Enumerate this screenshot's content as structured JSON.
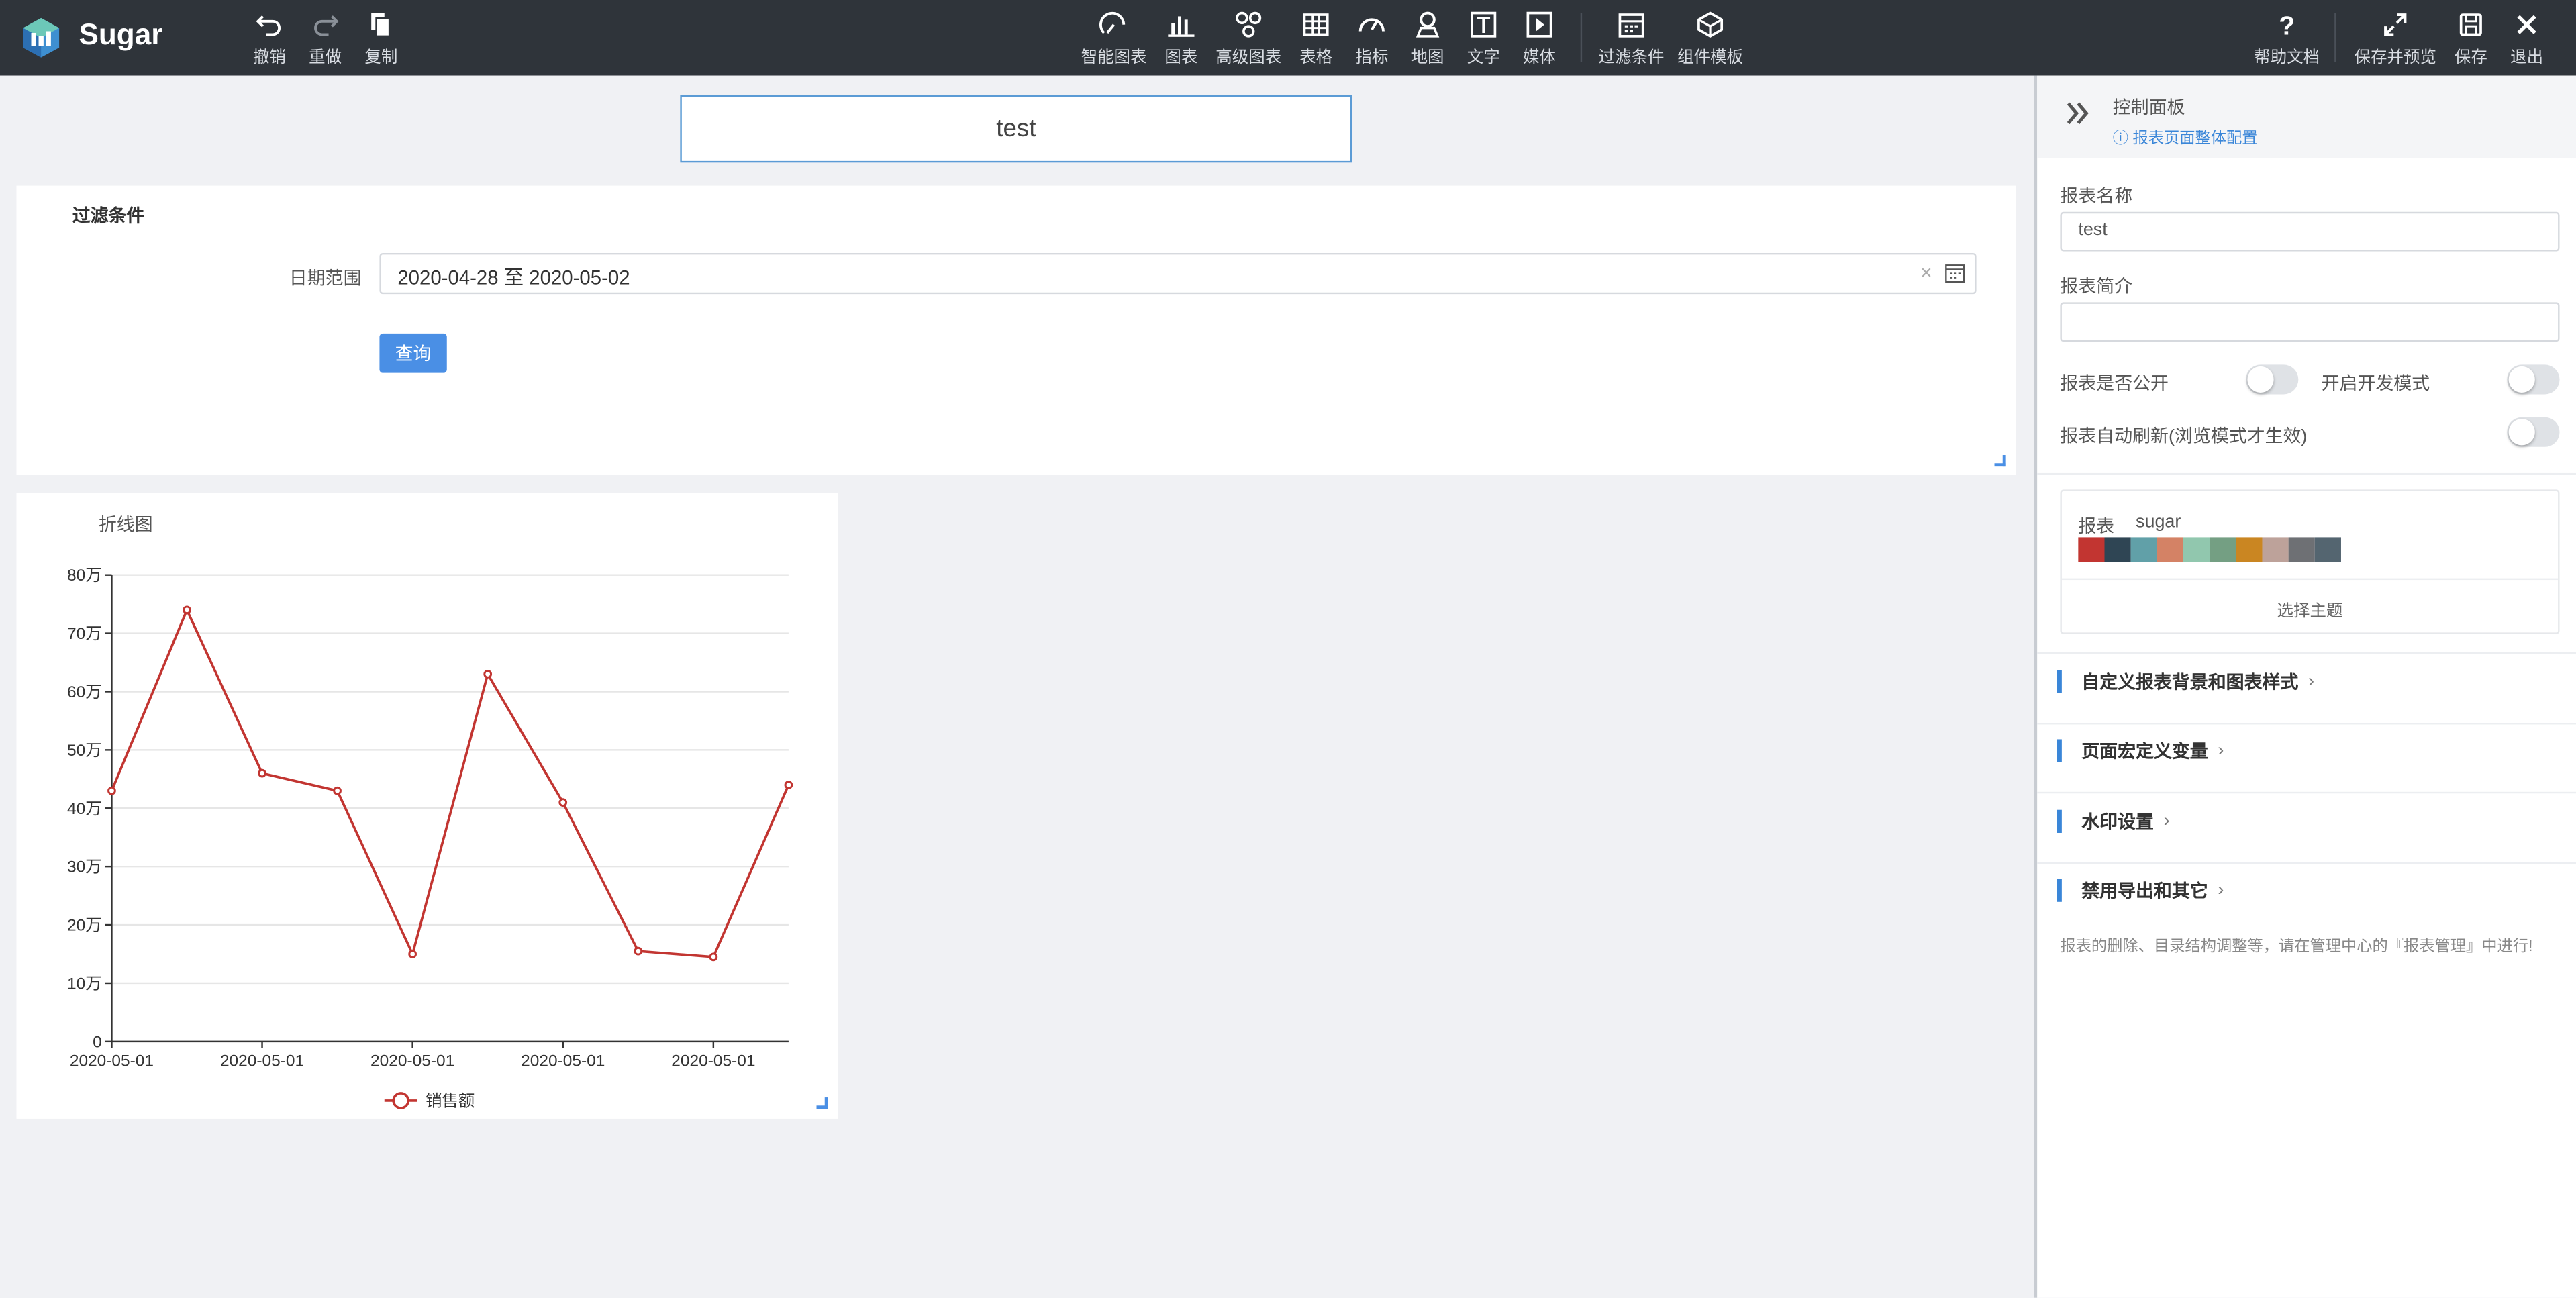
{
  "app": {
    "brand": "Sugar"
  },
  "toolbar": {
    "left": [
      {
        "label": "撤销",
        "icon": "undo-icon"
      },
      {
        "label": "重做",
        "icon": "redo-icon"
      },
      {
        "label": "复制",
        "icon": "copy-icon"
      }
    ],
    "center": [
      {
        "label": "智能图表",
        "icon": "smart-chart-icon"
      },
      {
        "label": "图表",
        "icon": "bar-chart-icon"
      },
      {
        "label": "高级图表",
        "icon": "advanced-chart-icon"
      },
      {
        "label": "表格",
        "icon": "table-icon"
      },
      {
        "label": "指标",
        "icon": "gauge-icon"
      },
      {
        "label": "地图",
        "icon": "map-pin-icon"
      },
      {
        "label": "文字",
        "icon": "text-icon"
      },
      {
        "label": "媒体",
        "icon": "media-icon"
      },
      {
        "label": "过滤条件",
        "icon": "filter-calendar-icon"
      },
      {
        "label": "组件模板",
        "icon": "template-icon"
      }
    ],
    "right": [
      {
        "label": "帮助文档",
        "icon": "help-icon"
      },
      {
        "label": "保存并预览",
        "icon": "expand-icon"
      },
      {
        "label": "保存",
        "icon": "save-icon"
      },
      {
        "label": "退出",
        "icon": "close-icon"
      }
    ]
  },
  "canvas": {
    "report_title": "test",
    "filter": {
      "title": "过滤条件",
      "date_label": "日期范围",
      "date_value": "2020-04-28 至 2020-05-02",
      "clear": "×",
      "query_button": "查询"
    }
  },
  "chart_data": {
    "type": "line",
    "title": "折线图",
    "x": [
      "2020-05-01",
      "",
      "2020-05-01",
      "",
      "2020-05-01",
      "",
      "2020-05-01",
      "",
      "2020-05-01",
      ""
    ],
    "x_tick_labels": [
      "2020-05-01",
      "2020-05-01",
      "2020-05-01",
      "2020-05-01",
      "2020-05-01"
    ],
    "y_ticks": [
      "0",
      "10万",
      "20万",
      "30万",
      "40万",
      "50万",
      "60万",
      "70万",
      "80万"
    ],
    "ylim": [
      0,
      800000
    ],
    "series": [
      {
        "name": "销售额",
        "color": "#c23531",
        "values": [
          430000,
          740000,
          460000,
          430000,
          150000,
          630000,
          410000,
          155000,
          145000,
          440000
        ]
      }
    ],
    "legend_position": "bottom-center",
    "grid": true
  },
  "right_panel": {
    "title": "控制面板",
    "subtitle": "报表页面整体配置",
    "name_label": "报表名称",
    "name_value": "test",
    "desc_label": "报表简介",
    "desc_value": "",
    "public_label": "报表是否公开",
    "dev_label": "开启开发模式",
    "refresh_label": "报表自动刷新(浏览模式才生效)",
    "theme": {
      "label1": "报表",
      "label2": "sugar",
      "colors": [
        "#c23531",
        "#2f4554",
        "#61a0a8",
        "#d48265",
        "#91c7ae",
        "#749f83",
        "#ca8622",
        "#bda29a",
        "#6e7074",
        "#546570"
      ],
      "select_label": "选择主题"
    },
    "sections": [
      "自定义报表背景和图表样式",
      "页面宏定义变量",
      "水印设置",
      "禁用导出和其它"
    ],
    "footnote": "报表的删除、目录结构调整等，请在管理中心的『报表管理』中进行!"
  }
}
